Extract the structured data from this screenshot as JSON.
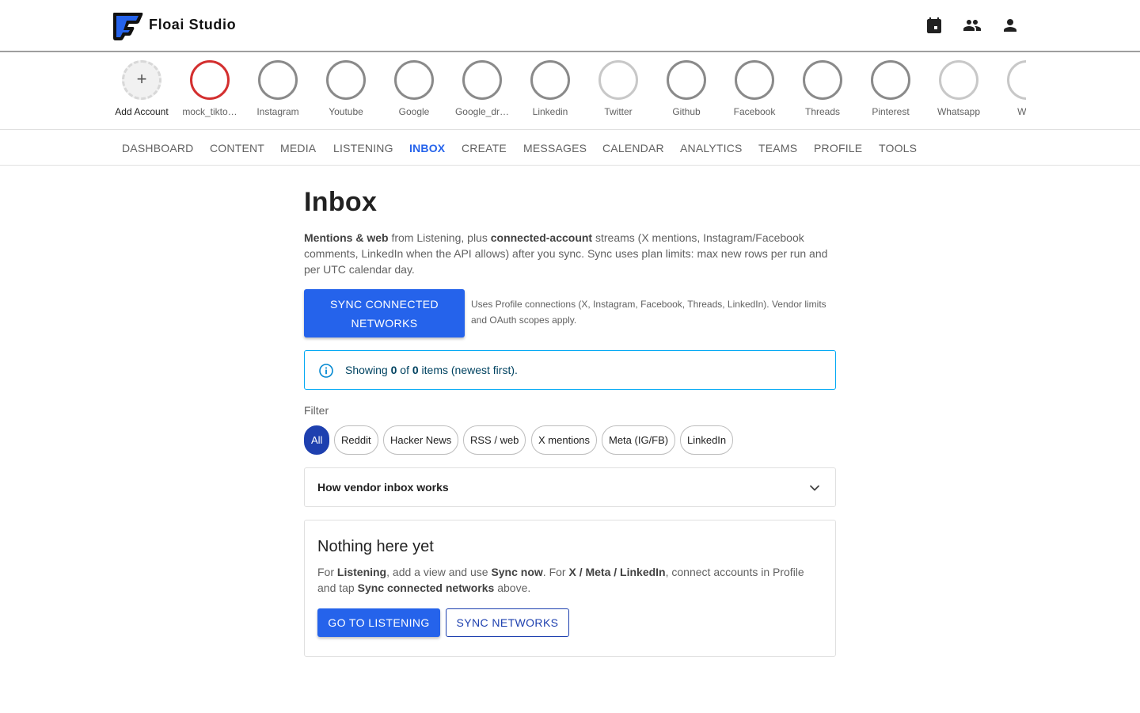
{
  "header": {
    "brand": "Floai Studio"
  },
  "header_icons": [
    "calendar-icon",
    "people-icon",
    "person-icon"
  ],
  "accounts": [
    {
      "name": "Add Account",
      "type": "add"
    },
    {
      "name": "mock_tikto…",
      "status": "error"
    },
    {
      "name": "Instagram"
    },
    {
      "name": "Youtube"
    },
    {
      "name": "Google"
    },
    {
      "name": "Google_dr…"
    },
    {
      "name": "Linkedin"
    },
    {
      "name": "Twitter",
      "status": "inactive"
    },
    {
      "name": "Github"
    },
    {
      "name": "Facebook"
    },
    {
      "name": "Threads"
    },
    {
      "name": "Pinterest"
    },
    {
      "name": "Whatsapp",
      "status": "inactive"
    },
    {
      "name": "Wec",
      "status": "inactive"
    }
  ],
  "nav": [
    "DASHBOARD",
    "CONTENT",
    "MEDIA",
    "LISTENING",
    "INBOX",
    "CREATE",
    "MESSAGES",
    "CALENDAR",
    "ANALYTICS",
    "TEAMS",
    "PROFILE",
    "TOOLS"
  ],
  "nav_active": "INBOX",
  "page": {
    "title": "Inbox",
    "intro": {
      "b1": "Mentions & web",
      "t1": " from Listening, plus ",
      "b2": "connected-account",
      "t2": " streams (X mentions, Instagram/Facebook comments, LinkedIn when the API allows) after you sync. Sync uses plan limits: max new rows per run and per UTC calendar day."
    },
    "sync_button": "SYNC CONNECTED NETWORKS",
    "sync_note": "Uses Profile connections (X, Instagram, Facebook, Threads, LinkedIn). Vendor limits and OAuth scopes apply.",
    "alert": {
      "prefix": "Showing ",
      "shown": "0",
      "mid": " of ",
      "total": "0",
      "suffix": " items (newest first)."
    },
    "filter_label": "Filter",
    "filters": [
      "All",
      "Reddit",
      "Hacker News",
      "RSS / web",
      "X mentions",
      "Meta (IG/FB)",
      "LinkedIn"
    ],
    "filter_active": "All",
    "accordion_title": "How vendor inbox works",
    "empty": {
      "title": "Nothing here yet",
      "t1": "For ",
      "b1": "Listening",
      "t2": ", add a view and use ",
      "b2": "Sync now",
      "t3": ". For ",
      "b3": "X / Meta / LinkedIn",
      "t4": ", connect accounts in Profile and tap ",
      "b4": "Sync connected networks",
      "t5": " above.",
      "primary_button": "GO TO LISTENING",
      "secondary_button": "SYNC NETWORKS"
    }
  },
  "colors": {
    "accent": "#2563eb",
    "accent_dark": "#1e40af",
    "error_ring": "#d32f2f",
    "info_border": "#03a9f4"
  }
}
